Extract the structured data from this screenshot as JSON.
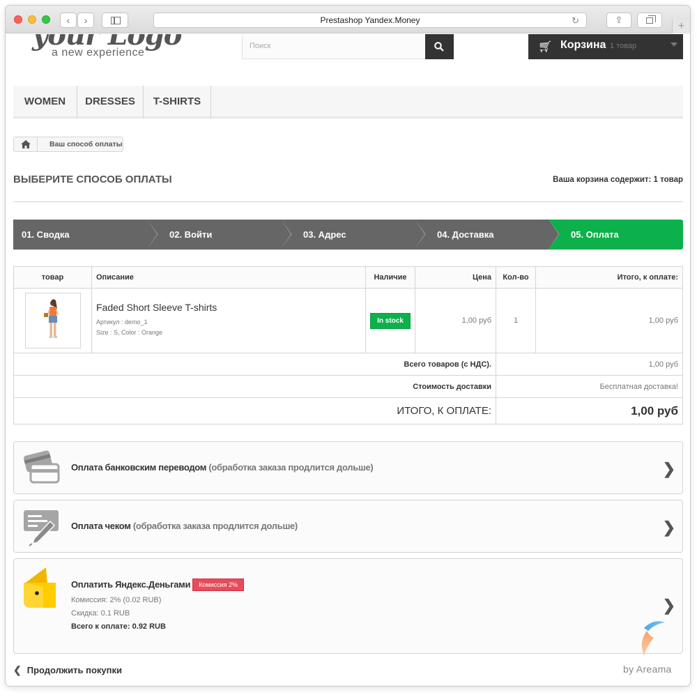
{
  "browser": {
    "url_title": "Prestashop Yandex.Money"
  },
  "header": {
    "logo_main": "your Logo",
    "logo_sub": "a new experience",
    "search_placeholder": "Поиск",
    "cart_label": "Корзина",
    "cart_count": "1 товар"
  },
  "menu": {
    "items": [
      "WOMEN",
      "DRESSES",
      "T-SHIRTS"
    ]
  },
  "breadcrumb": {
    "current": "Ваш способ оплаты"
  },
  "page": {
    "heading": "Выберите способ оплаты",
    "cart_summary": "Ваша корзина содержит: 1 товар"
  },
  "steps": [
    "01. Сводка",
    "02. Войти",
    "03. Адрес",
    "04. Доставка",
    "05. Оплата"
  ],
  "table": {
    "headers": {
      "product": "товар",
      "description": "Описание",
      "availability": "Наличие",
      "price": "Цена",
      "qty": "Кол-во",
      "total": "Итого, к оплате:"
    },
    "product": {
      "name": "Faded Short Sleeve T-shirts",
      "ref": "Артикул : demo_1",
      "attributes": "Size : S, Color : Orange",
      "availability": "In stock",
      "price": "1,00 руб",
      "qty": "1",
      "total": "1,00 руб"
    },
    "subtotal_label": "Всего товаров (с НДС).",
    "subtotal_value": "1,00 руб",
    "shipping_label": "Стоимость доставки",
    "shipping_value": "Бесплатная доставка!",
    "grand_label": "ИТОГО, К ОПЛАТЕ:",
    "grand_value": "1,00 руб"
  },
  "payments": {
    "bank": {
      "title": "Оплата банковским переводом",
      "note": "(обработка заказа продлится дольше)"
    },
    "check": {
      "title": "Оплата чеком",
      "note": "(обработка заказа продлится дольше)"
    },
    "yandex": {
      "title": "Оплатить Яндекс.Деньгами",
      "badge": "Комиссия 2%",
      "commission": "Комиссия: 2% (0.02 RUB)",
      "discount": "Скидка: 0.1 RUB",
      "total": "Всего к оплате: 0.92 RUB"
    }
  },
  "footer": {
    "continue": "Продолжить покупки",
    "by": "by  Areama"
  },
  "colors": {
    "dark": "#333333",
    "step_gray": "#666666",
    "step_active": "#0db14b",
    "stock_green": "#0db14b",
    "commission_red": "#ea4b5a",
    "yandex_yellow": "#ffcc00"
  }
}
